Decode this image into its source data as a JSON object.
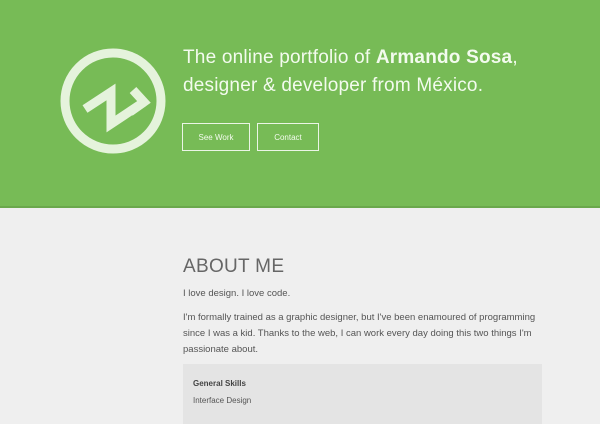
{
  "hero": {
    "tagline_prefix": "The online portfolio of ",
    "name": "Armando Sosa",
    "tagline_comma": ",",
    "tagline_line2": "designer & developer from México.",
    "buttons": {
      "see_work": "See Work",
      "contact": "Contact"
    },
    "logo_icon": "circle-monogram-logo",
    "colors": {
      "background": "#77bb56",
      "text": "#f3fbee",
      "logo": "#e5f3dc"
    }
  },
  "about": {
    "title": "ABOUT ME",
    "intro": "I love design. I love code.",
    "body": "I'm formally trained as a graphic designer, but I've been enamoured of programming since I was a kid. Thanks to the web, I can work every day doing this two things I'm passionate about.",
    "skills": {
      "title": "General Skills",
      "first_item": "Interface Design"
    },
    "colors": {
      "page_background": "#efefef",
      "skills_box": "#e4e4e4"
    }
  }
}
